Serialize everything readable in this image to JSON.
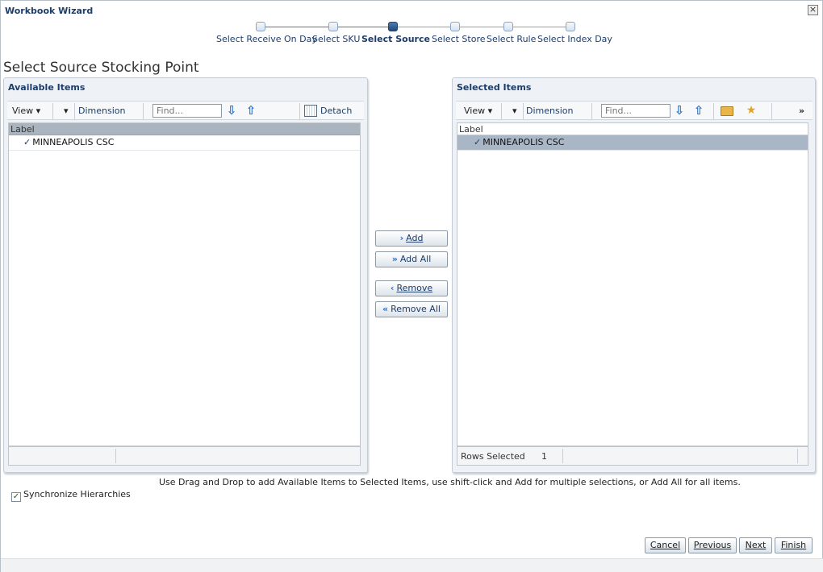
{
  "window": {
    "title": "Workbook Wizard",
    "close_glyph": "×"
  },
  "train": {
    "stops": [
      {
        "label": "Select Receive On Day",
        "state": "visited"
      },
      {
        "label": "Select SKU",
        "state": "visited"
      },
      {
        "label": "Select Source",
        "state": "current"
      },
      {
        "label": "Select Store",
        "state": "unvisited"
      },
      {
        "label": "Select Rule",
        "state": "unvisited"
      },
      {
        "label": "Select Index Day",
        "state": "unvisited"
      }
    ]
  },
  "page": {
    "title": "Select Source Stocking Point"
  },
  "available": {
    "title": "Available Items",
    "toolbar": {
      "view": "View ▾",
      "dimension": "Dimension",
      "find_placeholder": "Find...",
      "detach": "Detach"
    },
    "column": "Label",
    "rows": [
      "MINNEAPOLIS CSC"
    ]
  },
  "selected": {
    "title": "Selected Items",
    "toolbar": {
      "view": "View ▾",
      "dimension": "Dimension",
      "find_placeholder": "Find...",
      "more": "»"
    },
    "column": "Label",
    "rows": [
      "MINNEAPOLIS CSC"
    ],
    "footer": {
      "rows_selected_label": "Rows Selected",
      "rows_selected_value": "1"
    }
  },
  "shuttle": {
    "add": {
      "glyph": "›",
      "label": "Add"
    },
    "add_all": {
      "glyph": "»",
      "label": "Add All"
    },
    "remove": {
      "glyph": "‹",
      "label": "Remove"
    },
    "remove_all": {
      "glyph": "«",
      "label": "Remove All"
    }
  },
  "hint": "Use Drag and Drop to add Available Items to Selected Items, use shift-click and Add for multiple selections, or Add All for all items.",
  "sync": {
    "label": "Synchronize Hierarchies",
    "checked": true
  },
  "footer": {
    "cancel": "Cancel",
    "previous": "Previous",
    "next": "Next",
    "finish": "Finish"
  },
  "icons": {
    "check": "✓",
    "down_arrow": "⇩",
    "up_arrow": "⇧",
    "dropdown": "▾",
    "folder": "folder-open-icon",
    "star": "favorite-add-icon",
    "detach": "detach-icon"
  }
}
